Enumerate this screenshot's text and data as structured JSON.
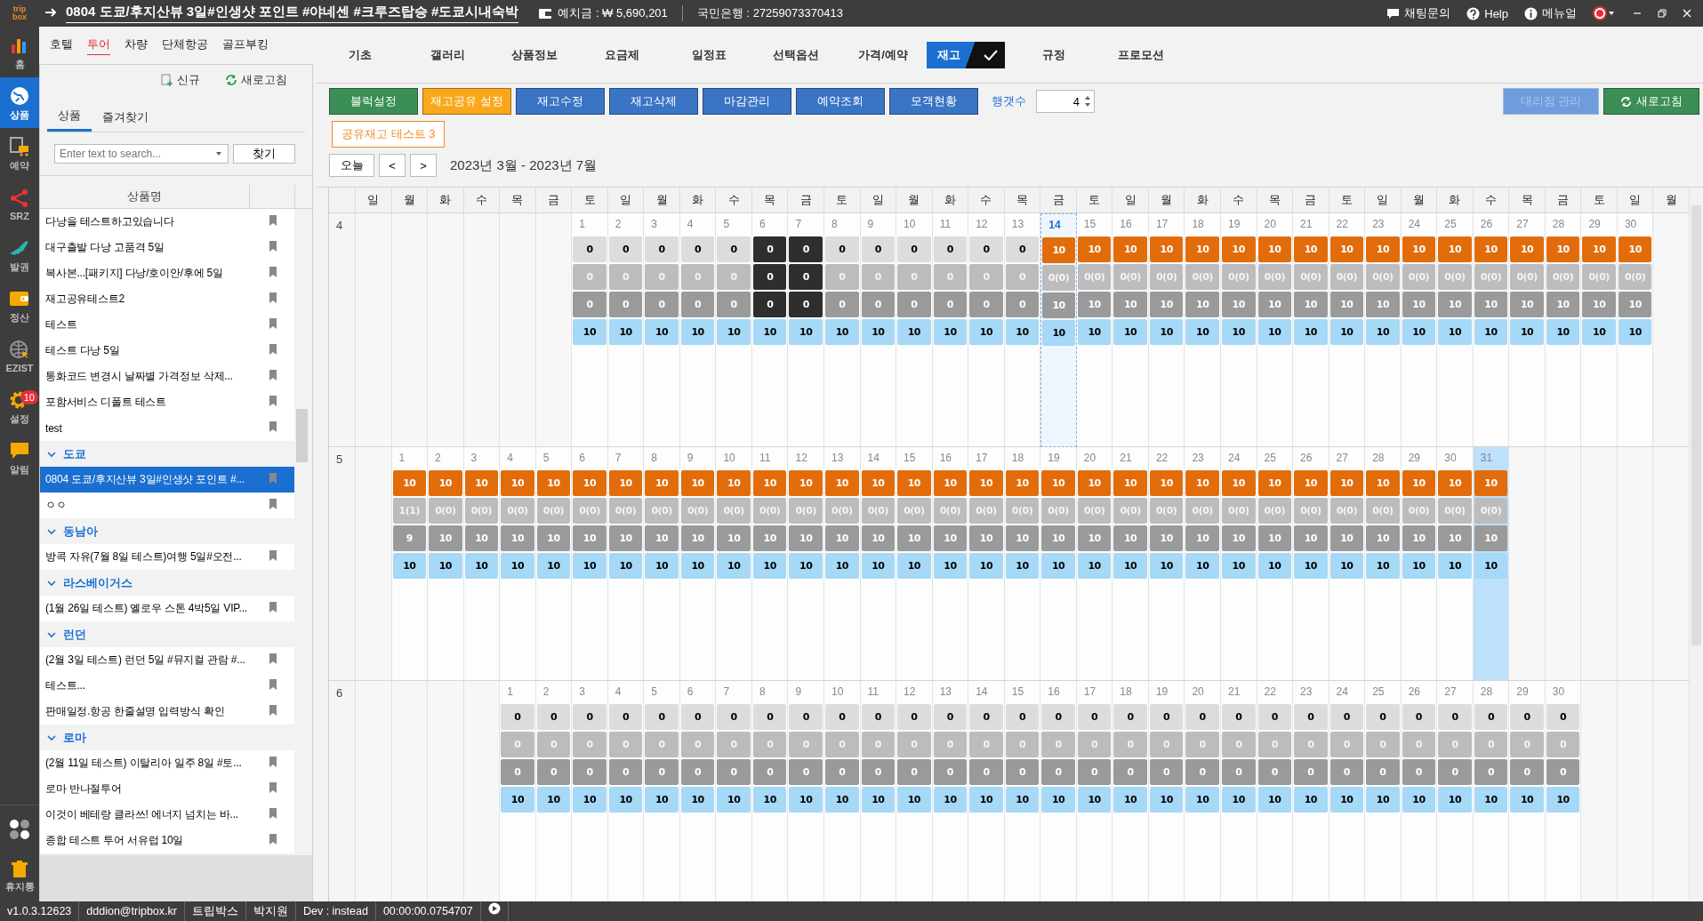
{
  "title_bar": {
    "logo": [
      "trip",
      "box"
    ],
    "title": "0804 도쿄/후지산뷰 3일#인생샷 포인트 #야네센 #크루즈탑승 #도쿄시내숙박",
    "deposit": "예치금 : ₩ 5,690,201",
    "bank": "국민은행 : 27259073370413",
    "links": [
      "채팅문의",
      "Help",
      "메뉴얼"
    ]
  },
  "rail": {
    "items": [
      {
        "label": "홈",
        "selected": false
      },
      {
        "label": "상품",
        "selected": true
      },
      {
        "label": "예약",
        "selected": false
      },
      {
        "label": "SRZ",
        "selected": false
      },
      {
        "label": "발권",
        "selected": false
      },
      {
        "label": "정산",
        "selected": false
      },
      {
        "label": "EZIST",
        "selected": false
      },
      {
        "label": "설정",
        "selected": false,
        "badge": "10"
      },
      {
        "label": "알림",
        "selected": false
      }
    ],
    "trash": "휴지통"
  },
  "categories": [
    {
      "label": "호텔",
      "selected": false
    },
    {
      "label": "투어",
      "selected": true
    },
    {
      "label": "차량",
      "selected": false
    },
    {
      "label": "단체항공",
      "selected": false
    },
    {
      "label": "골프부킹",
      "selected": false
    }
  ],
  "sidebar": {
    "new": "신규",
    "refresh": "새로고침",
    "tabs": [
      {
        "label": "상품",
        "selected": true
      },
      {
        "label": "즐겨찾기",
        "selected": false
      }
    ],
    "search": {
      "placeholder": "Enter text to search..."
    },
    "find": "찾기",
    "column": "상품명",
    "items": [
      {
        "label": "다낭을 테스트하고있습니다",
        "selected": false
      },
      {
        "label": "대구출발 다낭 고품격 5일",
        "selected": false
      },
      {
        "label": "복사본...[패키지] 다낭/호이안/후에 5일",
        "selected": false
      },
      {
        "label": "재고공유테스트2",
        "selected": false
      },
      {
        "label": "테스트",
        "selected": false
      },
      {
        "label": "테스트 다낭 5일",
        "selected": false
      },
      {
        "label": "통화코드 변경시 날짜별 가격정보 삭제...",
        "selected": false
      },
      {
        "label": "포함서비스 디폴트 테스트",
        "selected": false
      },
      {
        "label": "test",
        "selected": false
      }
    ],
    "groups": [
      {
        "label": "도쿄",
        "expanded": true,
        "items": [
          {
            "label": "0804 도쿄/후지산뷰 3일#인생샷 포인트 #...",
            "selected": true
          },
          {
            "label": "ㅇㅇ",
            "selected": false
          }
        ]
      },
      {
        "label": "동남아",
        "expanded": true,
        "items": [
          {
            "label": "방콕 자유(7월 8일 테스트)여행 5일#오전...",
            "selected": false
          }
        ]
      },
      {
        "label": "라스베이거스",
        "expanded": true,
        "items": [
          {
            "label": "(1월 26일 테스트) 옐로우 스톤 4박5일 VIP...",
            "selected": false
          }
        ]
      },
      {
        "label": "런던",
        "expanded": true,
        "items": [
          {
            "label": "(2월 3일 테스트) 런던 5일 #뮤지컬 관람 #...",
            "selected": false
          },
          {
            "label": "테스트...",
            "selected": false
          },
          {
            "label": "판매일정.항공 한줄설명 입력방식 확인",
            "selected": false
          }
        ]
      },
      {
        "label": "로마",
        "expanded": true,
        "items": [
          {
            "label": "(2월 11일 테스트) 이탈리아 일주 8일 #토...",
            "selected": false
          },
          {
            "label": "로마 반나절투어",
            "selected": false
          },
          {
            "label": "이것이 베테랑 클라쓰! 에너지 넘치는 바...",
            "selected": false
          },
          {
            "label": "종합 테스트 투어 서유럽 10일",
            "selected": false
          }
        ]
      }
    ]
  },
  "tabs": [
    {
      "label": "기초",
      "selected": false
    },
    {
      "label": "갤러리",
      "selected": false
    },
    {
      "label": "상품정보",
      "selected": false
    },
    {
      "label": "요금제",
      "selected": false
    },
    {
      "label": "일정표",
      "selected": false
    },
    {
      "label": "선택옵션",
      "selected": false
    },
    {
      "label": "가격/예약",
      "selected": false
    },
    {
      "label": "재고",
      "selected": true
    },
    {
      "label": "규정",
      "selected": false
    },
    {
      "label": "프로모션",
      "selected": false
    }
  ],
  "toolbar": {
    "buttons": [
      {
        "label": "블럭설정",
        "color": "#3b8e55",
        "disabled": false
      },
      {
        "label": "재고공유 설정",
        "color": "#f9a81b",
        "disabled": false
      },
      {
        "label": "재고수정",
        "color": "#3a74c4",
        "disabled": false
      },
      {
        "label": "재고삭제",
        "color": "#3a74c4",
        "disabled": false
      },
      {
        "label": "마감관리",
        "color": "#3a74c4",
        "disabled": false
      },
      {
        "label": "예약조회",
        "color": "#3a74c4",
        "disabled": false
      },
      {
        "label": "모객현황",
        "color": "#3a74c4",
        "disabled": false
      }
    ],
    "rows_label": "행갯수",
    "rows_value": "4",
    "right_buttons": [
      {
        "label": "대리점 관리",
        "color": "#6f9cdc",
        "disabled": true
      },
      {
        "label": "새로고침",
        "color": "#3b8e55",
        "disabled": false
      }
    ]
  },
  "shared_label": "공유재고 테스트 3",
  "calendar": {
    "today_button": "오늘",
    "prev": "<",
    "next": ">",
    "range": "2023년 3월 - 2023년 7월",
    "weekdays": [
      "일",
      "월",
      "화",
      "수",
      "목",
      "금",
      "토",
      "일",
      "월",
      "화",
      "수",
      "목",
      "금",
      "토",
      "일",
      "월",
      "화",
      "수",
      "목",
      "금",
      "토",
      "일",
      "월",
      "화",
      "수",
      "목",
      "금",
      "토",
      "일",
      "월",
      "화",
      "수",
      "목",
      "금",
      "토",
      "일",
      "월"
    ],
    "months": [
      {
        "label": "4",
        "days": [
          {
            "kind": "blank"
          },
          {
            "kind": "blank"
          },
          {
            "kind": "blank"
          },
          {
            "kind": "blank"
          },
          {
            "kind": "blank"
          },
          {
            "kind": "blank"
          },
          {
            "date": "1",
            "kind": "plain",
            "values": [
              "0",
              "0",
              "0",
              "10"
            ],
            "selected": false,
            "today": false
          },
          {
            "date": "2",
            "kind": "plain",
            "values": [
              "0",
              "0",
              "0",
              "10"
            ],
            "selected": false,
            "today": false
          },
          {
            "date": "3",
            "kind": "plain",
            "values": [
              "0",
              "0",
              "0",
              "10"
            ],
            "selected": false,
            "today": false
          },
          {
            "date": "4",
            "kind": "plain",
            "values": [
              "0",
              "0",
              "0",
              "10"
            ],
            "selected": false,
            "today": false
          },
          {
            "date": "5",
            "kind": "plain",
            "values": [
              "0",
              "0",
              "0",
              "10"
            ],
            "selected": false,
            "today": false
          },
          {
            "date": "6",
            "kind": "blocked",
            "values": [
              "0",
              "0",
              "0",
              "10"
            ],
            "selected": false,
            "today": false
          },
          {
            "date": "7",
            "kind": "blocked",
            "values": [
              "0",
              "0",
              "0",
              "10"
            ],
            "selected": false,
            "today": false
          },
          {
            "date": "8",
            "kind": "plain",
            "values": [
              "0",
              "0",
              "0",
              "10"
            ],
            "selected": false,
            "today": false
          },
          {
            "date": "9",
            "kind": "plain",
            "values": [
              "0",
              "0",
              "0",
              "10"
            ],
            "selected": false,
            "today": false
          },
          {
            "date": "10",
            "kind": "plain",
            "values": [
              "0",
              "0",
              "0",
              "10"
            ],
            "selected": false,
            "today": false
          },
          {
            "date": "11",
            "kind": "plain",
            "values": [
              "0",
              "0",
              "0",
              "10"
            ],
            "selected": false,
            "today": false
          },
          {
            "date": "12",
            "kind": "plain",
            "values": [
              "0",
              "0",
              "0",
              "10"
            ],
            "selected": false,
            "today": false
          },
          {
            "date": "13",
            "kind": "plain",
            "values": [
              "0",
              "0",
              "0",
              "10"
            ],
            "selected": false,
            "today": false
          },
          {
            "date": "14",
            "kind": "shared",
            "values": [
              "10",
              "0(0)",
              "10",
              "10"
            ],
            "selected": false,
            "today": true
          },
          {
            "date": "15",
            "kind": "shared",
            "values": [
              "10",
              "0(0)",
              "10",
              "10"
            ],
            "selected": false,
            "today": false
          },
          {
            "date": "16",
            "kind": "shared",
            "values": [
              "10",
              "0(0)",
              "10",
              "10"
            ],
            "selected": false,
            "today": false
          },
          {
            "date": "17",
            "kind": "shared",
            "values": [
              "10",
              "0(0)",
              "10",
              "10"
            ],
            "selected": false,
            "today": false
          },
          {
            "date": "18",
            "kind": "shared",
            "values": [
              "10",
              "0(0)",
              "10",
              "10"
            ],
            "selected": false,
            "today": false
          },
          {
            "date": "19",
            "kind": "shared",
            "values": [
              "10",
              "0(0)",
              "10",
              "10"
            ],
            "selected": false,
            "today": false
          },
          {
            "date": "20",
            "kind": "shared",
            "values": [
              "10",
              "0(0)",
              "10",
              "10"
            ],
            "selected": false,
            "today": false
          },
          {
            "date": "21",
            "kind": "shared",
            "values": [
              "10",
              "0(0)",
              "10",
              "10"
            ],
            "selected": false,
            "today": false
          },
          {
            "date": "22",
            "kind": "shared",
            "values": [
              "10",
              "0(0)",
              "10",
              "10"
            ],
            "selected": false,
            "today": false
          },
          {
            "date": "23",
            "kind": "shared",
            "values": [
              "10",
              "0(0)",
              "10",
              "10"
            ],
            "selected": false,
            "today": false
          },
          {
            "date": "24",
            "kind": "shared",
            "values": [
              "10",
              "0(0)",
              "10",
              "10"
            ],
            "selected": false,
            "today": false
          },
          {
            "date": "25",
            "kind": "shared",
            "values": [
              "10",
              "0(0)",
              "10",
              "10"
            ],
            "selected": false,
            "today": false
          },
          {
            "date": "26",
            "kind": "shared",
            "values": [
              "10",
              "0(0)",
              "10",
              "10"
            ],
            "selected": false,
            "today": false
          },
          {
            "date": "27",
            "kind": "shared",
            "values": [
              "10",
              "0(0)",
              "10",
              "10"
            ],
            "selected": false,
            "today": false
          },
          {
            "date": "28",
            "kind": "shared",
            "values": [
              "10",
              "0(0)",
              "10",
              "10"
            ],
            "selected": false,
            "today": false
          },
          {
            "date": "29",
            "kind": "shared",
            "values": [
              "10",
              "0(0)",
              "10",
              "10"
            ],
            "selected": false,
            "today": false
          },
          {
            "date": "30",
            "kind": "shared",
            "values": [
              "10",
              "0(0)",
              "10",
              "10"
            ],
            "selected": false,
            "today": false
          }
        ]
      },
      {
        "label": "5",
        "days": [
          {
            "kind": "blank"
          },
          {
            "date": "1",
            "kind": "shared",
            "values": [
              "10",
              "1(1)",
              "9",
              "10"
            ],
            "selected": false,
            "today": false
          },
          {
            "date": "2",
            "kind": "shared",
            "values": [
              "10",
              "0(0)",
              "10",
              "10"
            ],
            "selected": false,
            "today": false
          },
          {
            "date": "3",
            "kind": "shared",
            "values": [
              "10",
              "0(0)",
              "10",
              "10"
            ],
            "selected": false,
            "today": false
          },
          {
            "date": "4",
            "kind": "shared",
            "values": [
              "10",
              "0(0)",
              "10",
              "10"
            ],
            "selected": false,
            "today": false
          },
          {
            "date": "5",
            "kind": "shared",
            "values": [
              "10",
              "0(0)",
              "10",
              "10"
            ],
            "selected": false,
            "today": false
          },
          {
            "date": "6",
            "kind": "shared",
            "values": [
              "10",
              "0(0)",
              "10",
              "10"
            ],
            "selected": false,
            "today": false
          },
          {
            "date": "7",
            "kind": "shared",
            "values": [
              "10",
              "0(0)",
              "10",
              "10"
            ],
            "selected": false,
            "today": false
          },
          {
            "date": "8",
            "kind": "shared",
            "values": [
              "10",
              "0(0)",
              "10",
              "10"
            ],
            "selected": false,
            "today": false
          },
          {
            "date": "9",
            "kind": "shared",
            "values": [
              "10",
              "0(0)",
              "10",
              "10"
            ],
            "selected": false,
            "today": false
          },
          {
            "date": "10",
            "kind": "shared",
            "values": [
              "10",
              "0(0)",
              "10",
              "10"
            ],
            "selected": false,
            "today": false
          },
          {
            "date": "11",
            "kind": "shared",
            "values": [
              "10",
              "0(0)",
              "10",
              "10"
            ],
            "selected": false,
            "today": false
          },
          {
            "date": "12",
            "kind": "shared",
            "values": [
              "10",
              "0(0)",
              "10",
              "10"
            ],
            "selected": false,
            "today": false
          },
          {
            "date": "13",
            "kind": "shared",
            "values": [
              "10",
              "0(0)",
              "10",
              "10"
            ],
            "selected": false,
            "today": false
          },
          {
            "date": "14",
            "kind": "shared",
            "values": [
              "10",
              "0(0)",
              "10",
              "10"
            ],
            "selected": false,
            "today": false
          },
          {
            "date": "15",
            "kind": "shared",
            "values": [
              "10",
              "0(0)",
              "10",
              "10"
            ],
            "selected": false,
            "today": false
          },
          {
            "date": "16",
            "kind": "shared",
            "values": [
              "10",
              "0(0)",
              "10",
              "10"
            ],
            "selected": false,
            "today": false
          },
          {
            "date": "17",
            "kind": "shared",
            "values": [
              "10",
              "0(0)",
              "10",
              "10"
            ],
            "selected": false,
            "today": false
          },
          {
            "date": "18",
            "kind": "shared",
            "values": [
              "10",
              "0(0)",
              "10",
              "10"
            ],
            "selected": false,
            "today": false
          },
          {
            "date": "19",
            "kind": "shared",
            "values": [
              "10",
              "0(0)",
              "10",
              "10"
            ],
            "selected": false,
            "today": false
          },
          {
            "date": "20",
            "kind": "shared",
            "values": [
              "10",
              "0(0)",
              "10",
              "10"
            ],
            "selected": false,
            "today": false
          },
          {
            "date": "21",
            "kind": "shared",
            "values": [
              "10",
              "0(0)",
              "10",
              "10"
            ],
            "selected": false,
            "today": false
          },
          {
            "date": "22",
            "kind": "shared",
            "values": [
              "10",
              "0(0)",
              "10",
              "10"
            ],
            "selected": false,
            "today": false
          },
          {
            "date": "23",
            "kind": "shared",
            "values": [
              "10",
              "0(0)",
              "10",
              "10"
            ],
            "selected": false,
            "today": false
          },
          {
            "date": "24",
            "kind": "shared",
            "values": [
              "10",
              "0(0)",
              "10",
              "10"
            ],
            "selected": false,
            "today": false
          },
          {
            "date": "25",
            "kind": "shared",
            "values": [
              "10",
              "0(0)",
              "10",
              "10"
            ],
            "selected": false,
            "today": false
          },
          {
            "date": "26",
            "kind": "shared",
            "values": [
              "10",
              "0(0)",
              "10",
              "10"
            ],
            "selected": false,
            "today": false
          },
          {
            "date": "27",
            "kind": "shared",
            "values": [
              "10",
              "0(0)",
              "10",
              "10"
            ],
            "selected": false,
            "today": false
          },
          {
            "date": "28",
            "kind": "shared",
            "values": [
              "10",
              "0(0)",
              "10",
              "10"
            ],
            "selected": false,
            "today": false
          },
          {
            "date": "29",
            "kind": "shared",
            "values": [
              "10",
              "0(0)",
              "10",
              "10"
            ],
            "selected": false,
            "today": false
          },
          {
            "date": "30",
            "kind": "shared",
            "values": [
              "10",
              "0(0)",
              "10",
              "10"
            ],
            "selected": false,
            "today": false
          },
          {
            "date": "31",
            "kind": "shared",
            "values": [
              "10",
              "0(0)",
              "10",
              "10"
            ],
            "selected": true,
            "today": false
          }
        ]
      },
      {
        "label": "6",
        "days": [
          {
            "kind": "blank"
          },
          {
            "kind": "blank"
          },
          {
            "kind": "blank"
          },
          {
            "kind": "blank"
          },
          {
            "date": "1",
            "kind": "plain",
            "values": [
              "0",
              "0",
              "0",
              "10"
            ],
            "selected": false,
            "today": false
          },
          {
            "date": "2",
            "kind": "plain",
            "values": [
              "0",
              "0",
              "0",
              "10"
            ],
            "selected": false,
            "today": false
          },
          {
            "date": "3",
            "kind": "plain",
            "values": [
              "0",
              "0",
              "0",
              "10"
            ],
            "selected": false,
            "today": false
          },
          {
            "date": "4",
            "kind": "plain",
            "values": [
              "0",
              "0",
              "0",
              "10"
            ],
            "selected": false,
            "today": false
          },
          {
            "date": "5",
            "kind": "plain",
            "values": [
              "0",
              "0",
              "0",
              "10"
            ],
            "selected": false,
            "today": false
          },
          {
            "date": "6",
            "kind": "plain",
            "values": [
              "0",
              "0",
              "0",
              "10"
            ],
            "selected": false,
            "today": false
          },
          {
            "date": "7",
            "kind": "plain",
            "values": [
              "0",
              "0",
              "0",
              "10"
            ],
            "selected": false,
            "today": false
          },
          {
            "date": "8",
            "kind": "plain",
            "values": [
              "0",
              "0",
              "0",
              "10"
            ],
            "selected": false,
            "today": false
          },
          {
            "date": "9",
            "kind": "plain",
            "values": [
              "0",
              "0",
              "0",
              "10"
            ],
            "selected": false,
            "today": false
          },
          {
            "date": "10",
            "kind": "plain",
            "values": [
              "0",
              "0",
              "0",
              "10"
            ],
            "selected": false,
            "today": false
          },
          {
            "date": "11",
            "kind": "plain",
            "values": [
              "0",
              "0",
              "0",
              "10"
            ],
            "selected": false,
            "today": false
          },
          {
            "date": "12",
            "kind": "plain",
            "values": [
              "0",
              "0",
              "0",
              "10"
            ],
            "selected": false,
            "today": false
          },
          {
            "date": "13",
            "kind": "plain",
            "values": [
              "0",
              "0",
              "0",
              "10"
            ],
            "selected": false,
            "today": false
          },
          {
            "date": "14",
            "kind": "plain",
            "values": [
              "0",
              "0",
              "0",
              "10"
            ],
            "selected": false,
            "today": false
          },
          {
            "date": "15",
            "kind": "plain",
            "values": [
              "0",
              "0",
              "0",
              "10"
            ],
            "selected": false,
            "today": false
          },
          {
            "date": "16",
            "kind": "plain",
            "values": [
              "0",
              "0",
              "0",
              "10"
            ],
            "selected": false,
            "today": false
          },
          {
            "date": "17",
            "kind": "plain",
            "values": [
              "0",
              "0",
              "0",
              "10"
            ],
            "selected": false,
            "today": false
          },
          {
            "date": "18",
            "kind": "plain",
            "values": [
              "0",
              "0",
              "0",
              "10"
            ],
            "selected": false,
            "today": false
          },
          {
            "date": "19",
            "kind": "plain",
            "values": [
              "0",
              "0",
              "0",
              "10"
            ],
            "selected": false,
            "today": false
          },
          {
            "date": "20",
            "kind": "plain",
            "values": [
              "0",
              "0",
              "0",
              "10"
            ],
            "selected": false,
            "today": false
          },
          {
            "date": "21",
            "kind": "plain",
            "values": [
              "0",
              "0",
              "0",
              "10"
            ],
            "selected": false,
            "today": false
          },
          {
            "date": "22",
            "kind": "plain",
            "values": [
              "0",
              "0",
              "0",
              "10"
            ],
            "selected": false,
            "today": false
          },
          {
            "date": "23",
            "kind": "plain",
            "values": [
              "0",
              "0",
              "0",
              "10"
            ],
            "selected": false,
            "today": false
          },
          {
            "date": "24",
            "kind": "plain",
            "values": [
              "0",
              "0",
              "0",
              "10"
            ],
            "selected": false,
            "today": false
          },
          {
            "date": "25",
            "kind": "plain",
            "values": [
              "0",
              "0",
              "0",
              "10"
            ],
            "selected": false,
            "today": false
          },
          {
            "date": "26",
            "kind": "plain",
            "values": [
              "0",
              "0",
              "0",
              "10"
            ],
            "selected": false,
            "today": false
          },
          {
            "date": "27",
            "kind": "plain",
            "values": [
              "0",
              "0",
              "0",
              "10"
            ],
            "selected": false,
            "today": false
          },
          {
            "date": "28",
            "kind": "plain",
            "values": [
              "0",
              "0",
              "0",
              "10"
            ],
            "selected": false,
            "today": false
          },
          {
            "date": "29",
            "kind": "plain",
            "values": [
              "0",
              "0",
              "0",
              "10"
            ],
            "selected": false,
            "today": false
          },
          {
            "date": "30",
            "kind": "plain",
            "values": [
              "0",
              "0",
              "0",
              "10"
            ],
            "selected": false,
            "today": false
          }
        ]
      }
    ]
  },
  "status_bar": [
    "v1.0.3.12623",
    "dddion@tripbox.kr",
    "트립박스",
    "박지원",
    "Dev : instead",
    "00:00:00.0754707"
  ]
}
